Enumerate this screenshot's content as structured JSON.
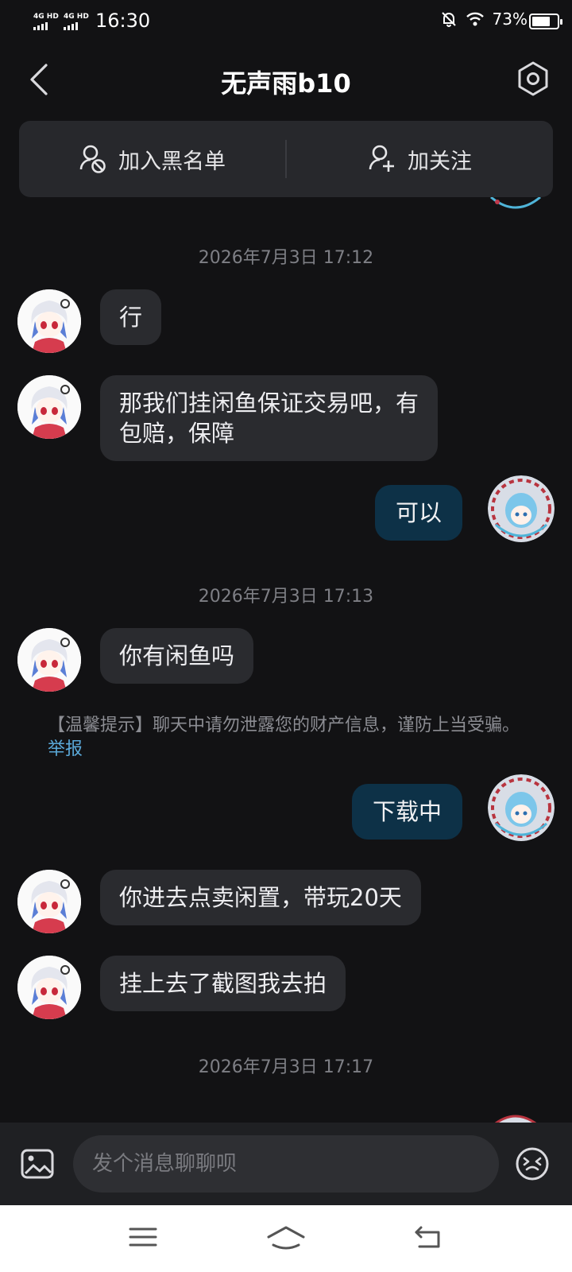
{
  "status_bar": {
    "sim1": "4G HD",
    "sim2": "4G HD",
    "time": "16:30",
    "battery_percent": "73%",
    "battery_level": 0.73,
    "icons": [
      "mute-icon",
      "wifi-icon",
      "battery-icon"
    ]
  },
  "header": {
    "title": "无声雨b10"
  },
  "actions": {
    "blacklist": "加入黑名单",
    "follow": "加关注"
  },
  "messages": {
    "ts1": "2026年7月3日 17:12",
    "m1": "行",
    "m2_line1": "那我们挂闲鱼保证交易吧，有",
    "m2_line2": "包赔，保障",
    "m3": "可以",
    "ts2": "2026年7月3日 17:13",
    "m4": "你有闲鱼吗",
    "tip_text": "【温馨提示】聊天中请勿泄露您的财产信息，谨防上当受骗。",
    "tip_link": "举报",
    "m5": "下载中",
    "m6": "你进去点卖闲置，带玩20天",
    "m7": "挂上去了截图我去拍",
    "ts3": "2026年7月3日 17:17"
  },
  "input": {
    "placeholder": "发个消息聊聊呗"
  },
  "colors": {
    "background": "#121214",
    "bubble_left": "#2a2b2f",
    "bubble_right": "#0d3147",
    "link": "#5aa8d8"
  }
}
